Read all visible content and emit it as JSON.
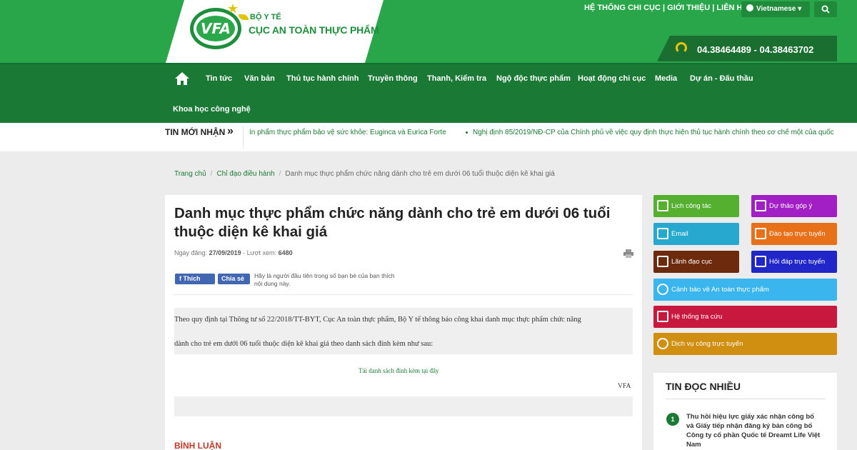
{
  "header": {
    "org_line1": "BỘ Y TẾ",
    "org_line2": "CỤC AN TOÀN THỰC PHẨM",
    "logo_text": "VFA",
    "top_links": "HỆ THỐNG CHI CỤC | GIỚI THIỆU | LIÊN HỆ",
    "language": "Vietnamese",
    "phone": "04.38464489 - 04.38463702",
    "colors": {
      "green": "#29a54a",
      "dark_green": "#1a7a35",
      "accent": "#f2c200"
    }
  },
  "nav": {
    "home_icon": "home-icon",
    "items": [
      "Tin tức",
      "Văn bản",
      "Thủ tục hành chính",
      "Truyền thông",
      "Thanh, Kiểm tra",
      "Ngộ độc thực phẩm",
      "Hoạt động chi cục",
      "Media",
      "Dự án - Đấu thầu",
      "Khoa học công nghệ"
    ]
  },
  "ticker": {
    "title": "TIN MỚI NHẬN",
    "item1": "ín phẩm thực phẩm bảo vệ sức khỏe: Euginca và Eurica Forte",
    "item2": "Nghị định 85/2019/NĐ-CP của Chính phủ về việc quy định thực hiện thủ tục hành chính theo cơ chế một của quốc"
  },
  "breadcrumb": {
    "home": "Trang chủ",
    "section": "Chỉ đạo điều hành",
    "current": "Danh mục thực phẩm chức năng dành cho trẻ em dưới 06 tuổi thuộc diện kê khai giá"
  },
  "article": {
    "title": "Danh mục thực phẩm chức năng dành cho trẻ em dưới 06 tuổi thuộc diện kê khai giá",
    "date_label": "Ngày đăng:",
    "date": "27/09/2019",
    "views_label": "- Lượt xem:",
    "views": "6480",
    "fb_like": "Thích",
    "fb_share": "Chia sẻ",
    "fb_note": "Hãy là người đầu tiên trong số bạn bè của bạn thích nội dung này.",
    "para1": "Theo quy định tại Thông tư số 22/2018/TT-BYT, Cục An toàn thực phẩm, Bộ Y tế thông báo công khai danh mục thực phẩm chức năng",
    "para2": "dành cho trẻ em dưới 06 tuổi thuộc diện kê khai giá theo danh sách đính kèm như sau:",
    "attachment": "Tải danh sách đính kèm tại đây",
    "signature": "VFA",
    "comments_title": "BÌNH LUẬN"
  },
  "sidebar": {
    "buttons": [
      {
        "label": "Lịch công tác",
        "color": "#56b030",
        "icon": "calendar-icon"
      },
      {
        "label": "Dự thảo góp ý",
        "color": "#a11fc4",
        "icon": "document-icon"
      },
      {
        "label": "Email",
        "color": "#27a9cf",
        "icon": "mail-icon"
      },
      {
        "label": "Đào tạo trực tuyến",
        "color": "#e87019",
        "icon": "graduation-icon"
      },
      {
        "label": "Lãnh đạo cục",
        "color": "#6e2a0c",
        "icon": "people-icon"
      },
      {
        "label": "Hỏi đáp trực tuyến",
        "color": "#2026c8",
        "icon": "chat-icon"
      },
      {
        "label": "Cảnh báo về An toàn thực phẩm",
        "color": "#3ab5ee",
        "icon": "info-icon"
      },
      {
        "label": "Hệ thống tra cứu",
        "color": "#c8183e",
        "icon": "checkbox-icon"
      },
      {
        "label": "Dịch vụ công trực tuyến",
        "color": "#d08f10",
        "icon": "check-circle-icon"
      }
    ],
    "popular_title": "TIN ĐỌC NHIỀU",
    "popular_items": [
      {
        "num": "1",
        "text": "Thu hồi hiệu lực giấy xác nhận công bố và Giấy tiếp nhận đăng ký bản công bố Công ty cổ phần Quốc tế Dreamt Life Việt Nam"
      }
    ]
  }
}
